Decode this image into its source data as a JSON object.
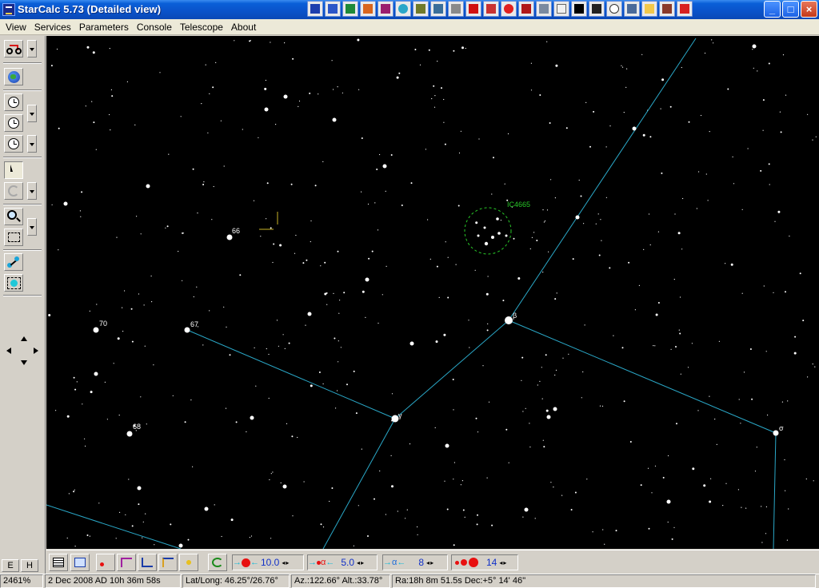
{
  "window": {
    "title": "StarCalc 5.73 (Detailed view)",
    "taskbar_icons": [
      "app-launcher-icon",
      "word-icon",
      "excel-icon",
      "powerpoint-icon",
      "publisher-icon",
      "network-icon",
      "puzzle-icon",
      "tools-icon",
      "document-icon",
      "n-icon",
      "slides-icon",
      "c-icon",
      "cards-icon",
      "usb-icon",
      "notepad-icon",
      "terminal-icon",
      "book-icon",
      "clock-icon",
      "camera-icon",
      "folder-icon",
      "briefcase-icon",
      "car-icon"
    ],
    "min_label": "_",
    "max_label": "□",
    "close_label": "×"
  },
  "menu": [
    "View",
    "Services",
    "Parameters",
    "Console",
    "Telescope",
    "About"
  ],
  "left_toolbar": {
    "e_label": "E",
    "h_label": "H"
  },
  "sky": {
    "background": "#000000",
    "line_color": "#2aa8c8",
    "label_color": "#ffffff",
    "object_label_color": "#28c828",
    "cluster_label": "IC4665",
    "labels": {
      "s66": "66",
      "s70": "70",
      "s67": "67",
      "s68": "68",
      "beta": "β",
      "gamma": "γ",
      "sigma": "σ"
    }
  },
  "bottom_toolbar": {
    "mag_limit": "10.0",
    "label_limit": "5.0",
    "alpha_value": "8",
    "star_size": "14",
    "alpha_glyph": "α",
    "alpha_arrow_prefix": "→",
    "alpha_arrow_suffix": "←",
    "dot_prefix": "→",
    "dot_suffix": "←",
    "label_prefix": "→",
    "label_suffix": "←",
    "spin_arrows": "◂▸"
  },
  "status": {
    "zoom": "2461%",
    "datetime": "2 Dec 2008 AD 10h 36m 58s",
    "latlong": "Lat/Long: 46.25°/26.76°",
    "azalt": "Az.:122.66° Alt.:33.78°",
    "radec": "Ra:18h 8m 51.5s Dec:+5° 14' 46''"
  }
}
